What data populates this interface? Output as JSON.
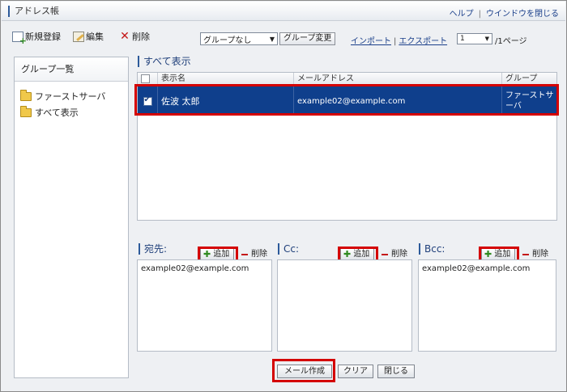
{
  "window": {
    "title": "アドレス帳",
    "links": {
      "help": "ヘルプ",
      "separator": "|",
      "close": "ウインドウを閉じる"
    }
  },
  "toolbar": {
    "new_label": "新規登録",
    "edit_label": "編集",
    "delete_label": "削除",
    "group_select_value": "グループなし",
    "group_change_label": "グループ変更",
    "import_label": "インポート",
    "link_separator": "|",
    "export_label": "エクスポート",
    "page_select_value": "1",
    "page_total": "/1ページ"
  },
  "sidebar": {
    "header": "グループ一覧",
    "items": [
      {
        "label": "ファーストサーバ",
        "icon": "folder-icon"
      },
      {
        "label": "すべて表示",
        "icon": "folder-icon"
      }
    ]
  },
  "list": {
    "title": "すべて表示",
    "columns": [
      "表示名",
      "メールアドレス",
      "グループ"
    ],
    "rows": [
      {
        "checked": true,
        "name": "佐波 太郎",
        "email": "example02@example.com",
        "group": "ファーストサーバ"
      }
    ]
  },
  "recipients": {
    "add_label": "追加",
    "delete_label": "削除",
    "to": {
      "label": "宛先:",
      "value": "example02@example.com"
    },
    "cc": {
      "label": "Cc:",
      "value": ""
    },
    "bcc": {
      "label": "Bcc:",
      "value": "example02@example.com"
    }
  },
  "footer": {
    "compose_label": "メール作成",
    "clear_label": "クリア",
    "close_label": "閉じる"
  },
  "colors": {
    "selected_row": "#0f3f8c",
    "highlight_box": "#d40000",
    "link": "#1a3f8a"
  }
}
